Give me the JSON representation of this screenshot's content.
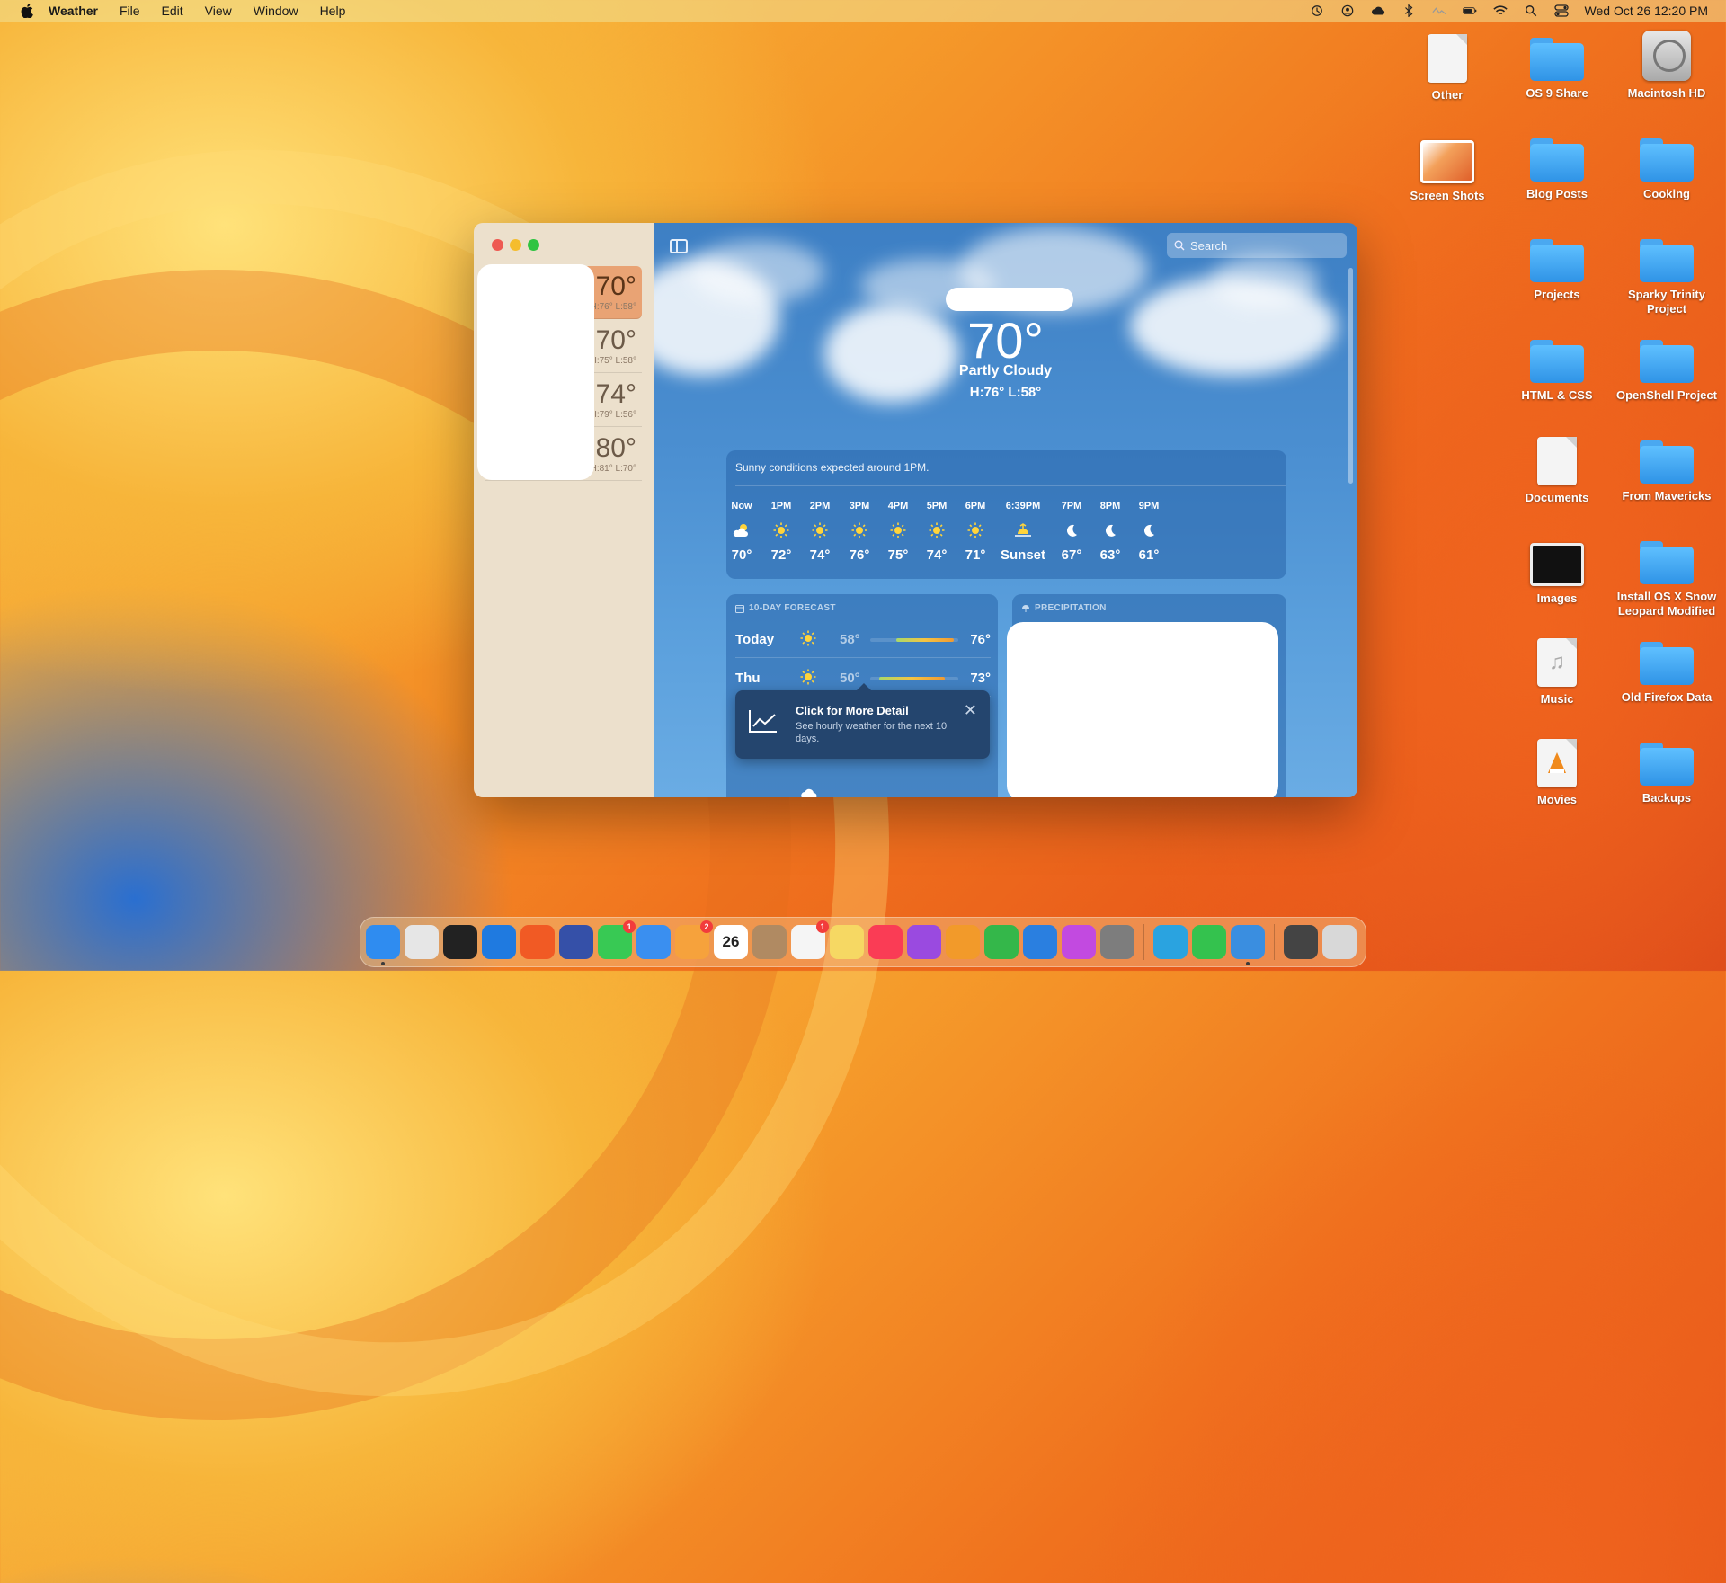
{
  "menubar": {
    "app_name": "Weather",
    "menus": [
      "File",
      "Edit",
      "View",
      "Window",
      "Help"
    ],
    "clock": "Wed Oct 26  12:20 PM",
    "status_icons": [
      "time-machine-icon",
      "user-icon",
      "cloud-icon",
      "bluetooth-icon",
      "activity-icon",
      "battery-icon",
      "wifi-icon",
      "spotlight-icon",
      "control-center-icon"
    ]
  },
  "desktop": {
    "icons": [
      {
        "label": "Other",
        "kind": "doc"
      },
      {
        "label": "OS 9 Share",
        "kind": "folder"
      },
      {
        "label": "Macintosh HD",
        "kind": "drive"
      },
      {
        "label": "Screen Shots",
        "kind": "image"
      },
      {
        "label": "Blog Posts",
        "kind": "folder"
      },
      {
        "label": "Cooking",
        "kind": "folder"
      },
      {
        "label": "Projects",
        "kind": "folder"
      },
      {
        "label": "Sparky Trinity Project",
        "kind": "folder"
      },
      {
        "label": "HTML & CSS",
        "kind": "folder"
      },
      {
        "label": "OpenShell Project",
        "kind": "folder"
      },
      {
        "label": "Documents",
        "kind": "doc"
      },
      {
        "label": "From Mavericks",
        "kind": "folder"
      },
      {
        "label": "Images",
        "kind": "image"
      },
      {
        "label": "Install OS X Snow Leopard Modified",
        "kind": "folder"
      },
      {
        "label": "Music",
        "kind": "doc"
      },
      {
        "label": "Old Firefox Data",
        "kind": "folder"
      },
      {
        "label": "Movies",
        "kind": "doc"
      },
      {
        "label": "Backups",
        "kind": "folder"
      }
    ]
  },
  "sidebar": {
    "locations": [
      {
        "temp": "70°",
        "hilo": "H:76° L:58°",
        "selected": true
      },
      {
        "temp": "70°",
        "hilo": "H:75° L:58°",
        "selected": false
      },
      {
        "temp": "74°",
        "hilo": "H:79° L:56°",
        "selected": false
      },
      {
        "temp": "80°",
        "hilo": "H:81° L:70°",
        "selected": false
      }
    ]
  },
  "main": {
    "search_placeholder": "Search",
    "current_temp": "70°",
    "condition": "Partly Cloudy",
    "hilo": "H:76°  L:58°",
    "hourly": {
      "summary": "Sunny conditions expected around 1PM.",
      "hours": [
        {
          "time": "Now",
          "icon": "partly-cloudy-icon",
          "value": "70°"
        },
        {
          "time": "1PM",
          "icon": "sun-icon",
          "value": "72°"
        },
        {
          "time": "2PM",
          "icon": "sun-icon",
          "value": "74°"
        },
        {
          "time": "3PM",
          "icon": "sun-icon",
          "value": "76°"
        },
        {
          "time": "4PM",
          "icon": "sun-icon",
          "value": "75°"
        },
        {
          "time": "5PM",
          "icon": "sun-icon",
          "value": "74°"
        },
        {
          "time": "6PM",
          "icon": "sun-icon",
          "value": "71°"
        },
        {
          "time": "6:39PM",
          "icon": "sunset-icon",
          "value": "Sunset"
        },
        {
          "time": "7PM",
          "icon": "moon-icon",
          "value": "67°"
        },
        {
          "time": "8PM",
          "icon": "moon-icon",
          "value": "63°"
        },
        {
          "time": "9PM",
          "icon": "moon-icon",
          "value": "61°"
        }
      ]
    },
    "forecast": {
      "title": "10-DAY FORECAST",
      "days": [
        {
          "day": "Today",
          "icon": "sun-icon",
          "low": "58°",
          "high": "76°",
          "range_start": 0.3,
          "range_end": 0.95
        },
        {
          "day": "Thu",
          "icon": "sun-icon",
          "low": "50°",
          "high": "73°",
          "range_start": 0.1,
          "range_end": 0.85
        }
      ]
    },
    "tooltip": {
      "title": "Click for More Detail",
      "description": "See hourly weather for the next 10 days."
    },
    "precipitation": {
      "title": "PRECIPITATION"
    }
  },
  "dock": {
    "items": [
      {
        "name": "Finder",
        "color": "#2f8cf0",
        "running": true
      },
      {
        "name": "Launchpad",
        "color": "#e6e6e6"
      },
      {
        "name": "Terminal",
        "color": "#222222"
      },
      {
        "name": "Safari",
        "color": "#1f7ae0"
      },
      {
        "name": "Brave",
        "color": "#f15a24"
      },
      {
        "name": "Preview",
        "color": "#3550a8"
      },
      {
        "name": "Messages",
        "color": "#38c954",
        "badge": "1"
      },
      {
        "name": "Mail",
        "color": "#3a8ff0"
      },
      {
        "name": "Photos",
        "color": "#f6a23c",
        "badge": "2"
      },
      {
        "name": "Calendar",
        "color": "#ffffff",
        "text": "26"
      },
      {
        "name": "Contacts",
        "color": "#b08a62"
      },
      {
        "name": "Reminders",
        "color": "#f5f5f5",
        "badge": "1"
      },
      {
        "name": "Notes",
        "color": "#f6d863"
      },
      {
        "name": "Music",
        "color": "#fa3c55"
      },
      {
        "name": "Podcasts",
        "color": "#9a4ae0"
      },
      {
        "name": "Pages",
        "color": "#f29a2a"
      },
      {
        "name": "Numbers",
        "color": "#34b74a"
      },
      {
        "name": "Keynote",
        "color": "#2a7fe0"
      },
      {
        "name": "Flower",
        "color": "#c24ae0"
      },
      {
        "name": "System Settings",
        "color": "#7d7d7d"
      },
      {
        "name": "Telegram",
        "color": "#2aa3e0"
      },
      {
        "name": "FaceTime",
        "color": "#34c24e"
      },
      {
        "name": "Weather",
        "color": "#3a8ee0",
        "running": true
      },
      {
        "name": "Scanner",
        "color": "#444444"
      },
      {
        "name": "Trash",
        "color": "#d8d8d8"
      }
    ]
  }
}
